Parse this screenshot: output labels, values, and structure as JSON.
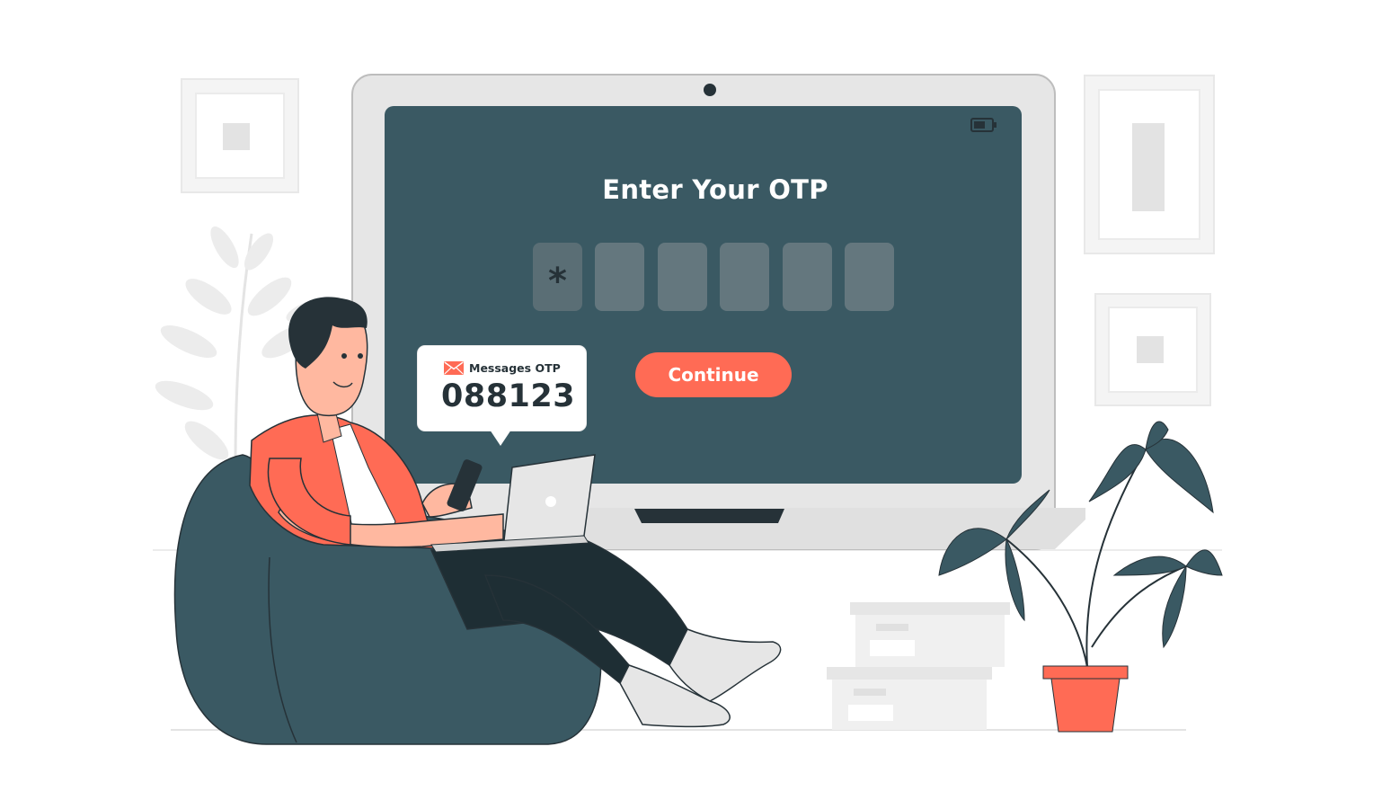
{
  "screen": {
    "title": "Enter Your OTP",
    "otp_slots": [
      "*",
      "",
      "",
      "",
      "",
      ""
    ],
    "continue_label": "Continue"
  },
  "message": {
    "icon": "envelope-icon",
    "label": "Messages OTP",
    "code": "088123"
  },
  "colors": {
    "screen": "#3a5963",
    "accent": "#ff6b55",
    "dark": "#263238",
    "frame": "#e6e6e6"
  }
}
